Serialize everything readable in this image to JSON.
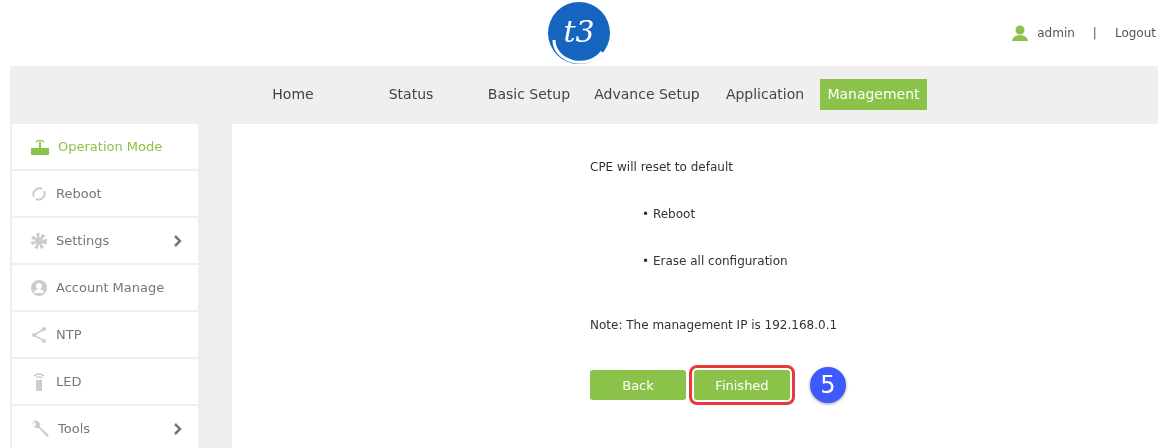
{
  "header": {
    "logo_text": "t3",
    "user": "admin",
    "separator": "|",
    "logout": "Logout"
  },
  "nav": [
    {
      "label": "Home",
      "selected": false
    },
    {
      "label": "Status",
      "selected": false
    },
    {
      "label": "Basic Setup",
      "selected": false
    },
    {
      "label": "Advance Setup",
      "selected": false
    },
    {
      "label": "Application",
      "selected": false
    },
    {
      "label": "Management",
      "selected": true
    }
  ],
  "sidebar": {
    "items": [
      {
        "label": "Operation Mode",
        "selected": true,
        "has_submenu": false
      },
      {
        "label": "Reboot",
        "selected": false,
        "has_submenu": false
      },
      {
        "label": "Settings",
        "selected": false,
        "has_submenu": true
      },
      {
        "label": "Account Manage",
        "selected": false,
        "has_submenu": false
      },
      {
        "label": "NTP",
        "selected": false,
        "has_submenu": false
      },
      {
        "label": "LED",
        "selected": false,
        "has_submenu": false
      },
      {
        "label": "Tools",
        "selected": false,
        "has_submenu": true
      }
    ]
  },
  "content": {
    "heading": "CPE will reset to default",
    "bullets": [
      "• Reboot",
      "• Erase all configuration"
    ],
    "note": "Note: The management IP is 192.168.0.1",
    "buttons": [
      {
        "label": "Back",
        "highlighted": false
      },
      {
        "label": "Finished",
        "highlighted": true
      }
    ],
    "step_badge": "5"
  }
}
